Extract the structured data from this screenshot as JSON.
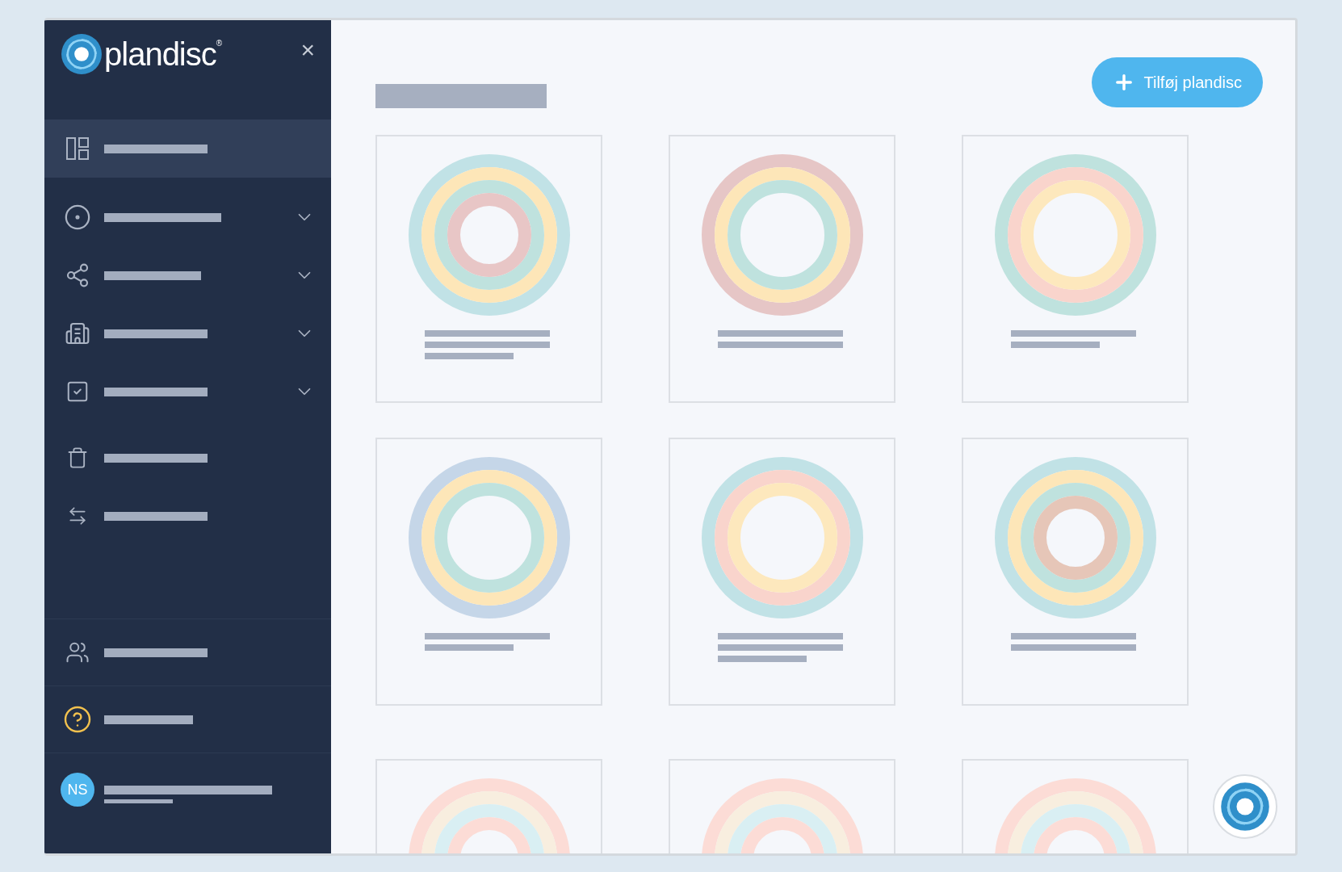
{
  "sidebar": {
    "logo": {
      "name": "plandisc",
      "mark": "®"
    },
    "close": "×",
    "items": [
      {
        "selected": true,
        "expandable": false
      },
      {
        "selected": false,
        "expandable": true
      },
      {
        "selected": false,
        "expandable": true
      },
      {
        "selected": false,
        "expandable": true
      },
      {
        "selected": false,
        "expandable": true
      },
      {
        "selected": false,
        "expandable": false
      },
      {
        "selected": false,
        "expandable": false
      }
    ],
    "user": {
      "initials": "NS"
    }
  },
  "main": {
    "add_button": "Tilføj plandisc",
    "cards": [
      {
        "rings": [
          {
            "color": "#c1e2e6"
          },
          {
            "color": "#fde6b8"
          },
          {
            "color": "#bfe2de"
          },
          {
            "color": "#e8c6c6"
          }
        ],
        "lines": [
          {
            "kind": "long"
          },
          {
            "kind": "long"
          },
          {
            "kind": "short"
          }
        ]
      },
      {
        "rings": [
          {
            "color": "#e6c6c6"
          },
          {
            "color": "#fde6b8"
          },
          {
            "color": "#bfe2de"
          }
        ],
        "lines": [
          {
            "kind": "long"
          },
          {
            "kind": "long"
          }
        ]
      },
      {
        "rings": [
          {
            "color": "#bfe2de"
          },
          {
            "color": "#f9d4cc"
          },
          {
            "color": "#fde8bd"
          }
        ],
        "lines": [
          {
            "kind": "long"
          },
          {
            "kind": "short"
          }
        ]
      },
      {
        "rings": [
          {
            "color": "#c5d6e8"
          },
          {
            "color": "#fde6b8"
          },
          {
            "color": "#bfe2de"
          }
        ],
        "lines": [
          {
            "kind": "long"
          },
          {
            "kind": "short"
          }
        ]
      },
      {
        "rings": [
          {
            "color": "#c1e2e6"
          },
          {
            "color": "#f9d4cc"
          },
          {
            "color": "#fde8bd"
          }
        ],
        "lines": [
          {
            "kind": "long"
          },
          {
            "kind": "long"
          },
          {
            "kind": "short"
          }
        ]
      },
      {
        "rings": [
          {
            "color": "#c1e2e6"
          },
          {
            "color": "#fde6b8"
          },
          {
            "color": "#bfe2de"
          },
          {
            "color": "#e6c6b8"
          }
        ],
        "lines": [
          {
            "kind": "long"
          },
          {
            "kind": "long"
          }
        ]
      },
      {
        "rings": [
          {
            "color": "#fcdcd6"
          },
          {
            "color": "#f8eedf"
          },
          {
            "color": "#d9eff3"
          },
          {
            "color": "#fcdcd6"
          }
        ]
      },
      {
        "rings": [
          {
            "color": "#fcdcd6"
          },
          {
            "color": "#f8eedf"
          },
          {
            "color": "#d9eff3"
          },
          {
            "color": "#fcdcd6"
          }
        ]
      },
      {
        "rings": [
          {
            "color": "#fcdcd6"
          },
          {
            "color": "#f8eedf"
          },
          {
            "color": "#d9eff3"
          },
          {
            "color": "#fcdcd6"
          }
        ]
      }
    ]
  }
}
